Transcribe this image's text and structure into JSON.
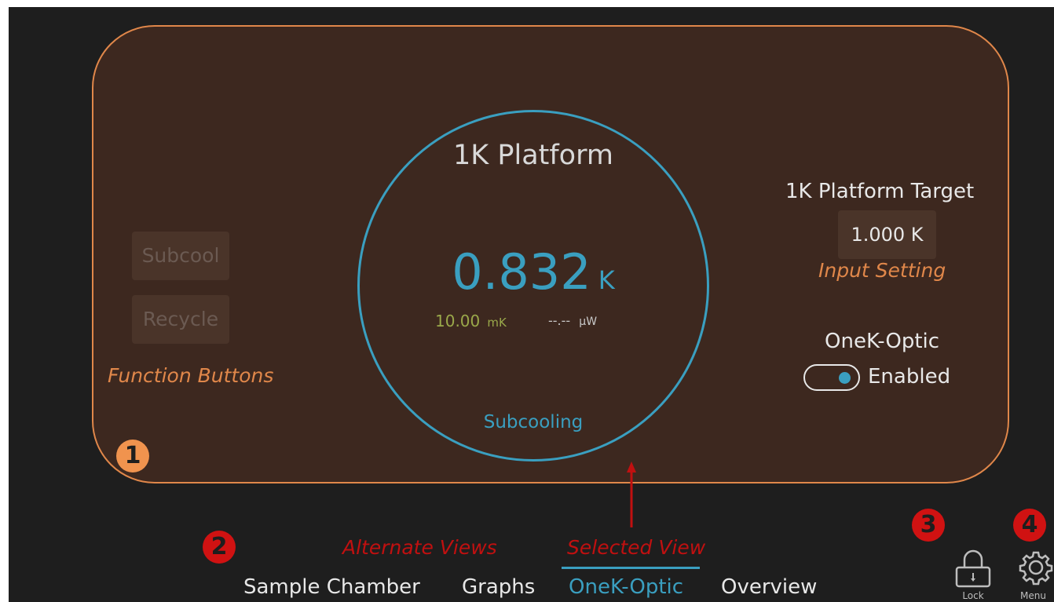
{
  "platform": {
    "title": "1K Platform",
    "temperature": "0.832",
    "temperature_unit": "K",
    "stability_value": "10.00",
    "stability_unit": "mK",
    "power_value": "--.--",
    "power_unit": "μW",
    "status": "Subcooling"
  },
  "functions": {
    "subcool_label": "Subcool",
    "recycle_label": "Recycle"
  },
  "target": {
    "label": "1K Platform Target",
    "value": "1.000 K"
  },
  "optic": {
    "label": "OneK-Optic",
    "toggle_state": "Enabled",
    "enabled": true
  },
  "tabs": [
    {
      "label": "Sample Chamber",
      "selected": false
    },
    {
      "label": "Graphs",
      "selected": false
    },
    {
      "label": "OneK-Optic",
      "selected": true
    },
    {
      "label": "Overview",
      "selected": false
    }
  ],
  "toolbar": {
    "lock_label": "Lock",
    "menu_label": "Menu"
  },
  "annotations": {
    "function_buttons": "Function Buttons",
    "input_setting": "Input Setting",
    "alternate_views": "Alternate Views",
    "selected_view": "Selected View",
    "badge1": "1",
    "badge2": "2",
    "badge3": "3",
    "badge4": "4"
  },
  "colors": {
    "accent_blue": "#3a9fc0",
    "annotation_orange": "#e0874a",
    "annotation_red": "#c01010",
    "stability_green": "#9aa84a",
    "panel_bg": "#3d281f"
  }
}
